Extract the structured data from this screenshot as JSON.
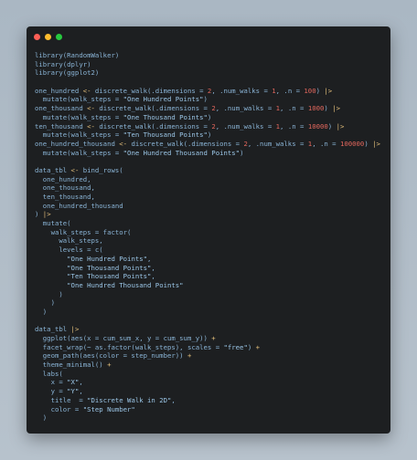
{
  "window": {
    "controls": {
      "close_color": "#ff5f56",
      "minimize_color": "#ffbd2e",
      "maximize_color": "#27c93f"
    }
  },
  "code": {
    "lines": [
      "library(RandomWalker)",
      "library(dplyr)",
      "library(ggplot2)",
      "",
      "one_hundred <- discrete_walk(.dimensions = 2, .num_walks = 1, .n = 100) |>",
      "  mutate(walk_steps = \"One Hundred Points\")",
      "one_thousand <- discrete_walk(.dimensions = 2, .num_walks = 1, .n = 1000) |>",
      "  mutate(walk_steps = \"One Thousand Points\")",
      "ten_thousand <- discrete_walk(.dimensions = 2, .num_walks = 1, .n = 10000) |>",
      "  mutate(walk_steps = \"Ten Thousand Points\")",
      "one_hundred_thousand <- discrete_walk(.dimensions = 2, .num_walks = 1, .n = 100000) |>",
      "  mutate(walk_steps = \"One Hundred Thousand Points\")",
      "",
      "data_tbl <- bind_rows(",
      "  one_hundred,",
      "  one_thousand,",
      "  ten_thousand,",
      "  one_hundred_thousand",
      ") |>",
      "  mutate(",
      "    walk_steps = factor(",
      "      walk_steps,",
      "      levels = c(",
      "        \"One Hundred Points\",",
      "        \"One Thousand Points\",",
      "        \"Ten Thousand Points\",",
      "        \"One Hundred Thousand Points\"",
      "      )",
      "    )",
      "  )",
      "",
      "data_tbl |>",
      "  ggplot(aes(x = cum_sum_x, y = cum_sum_y)) +",
      "  facet_wrap(~ as.factor(walk_steps), scales = \"free\") +",
      "  geom_path(aes(color = step_number)) +",
      "  theme_minimal() +",
      "  labs(",
      "    x = \"X\",",
      "    y = \"Y\",",
      "    title  = \"Discrete Walk in 2D\",",
      "    color = \"Step Number\"",
      "  )"
    ]
  }
}
